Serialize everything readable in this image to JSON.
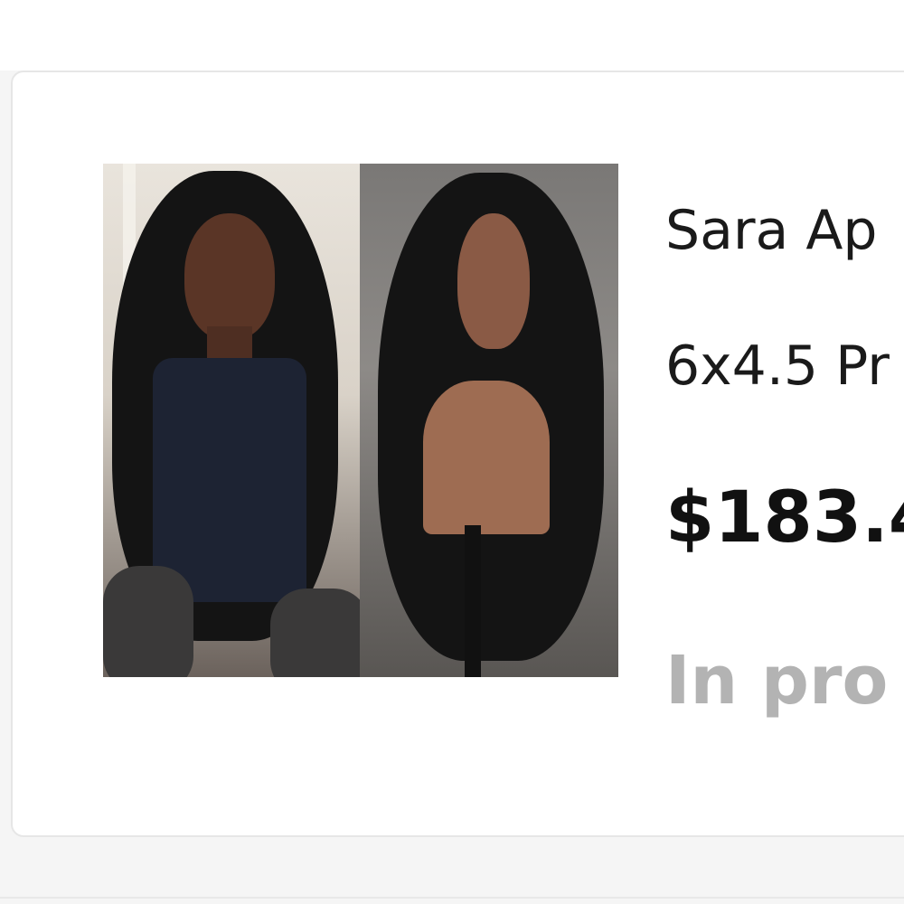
{
  "product": {
    "title": "Sara Ap",
    "subtitle": "6x4.5 Pr",
    "price": "$183.4",
    "status": "In pro"
  },
  "image": {
    "description_icon": "product-photo"
  },
  "colors": {
    "price": "#111111",
    "status": "#b3b3b3",
    "card_border": "#e6e6e6"
  }
}
